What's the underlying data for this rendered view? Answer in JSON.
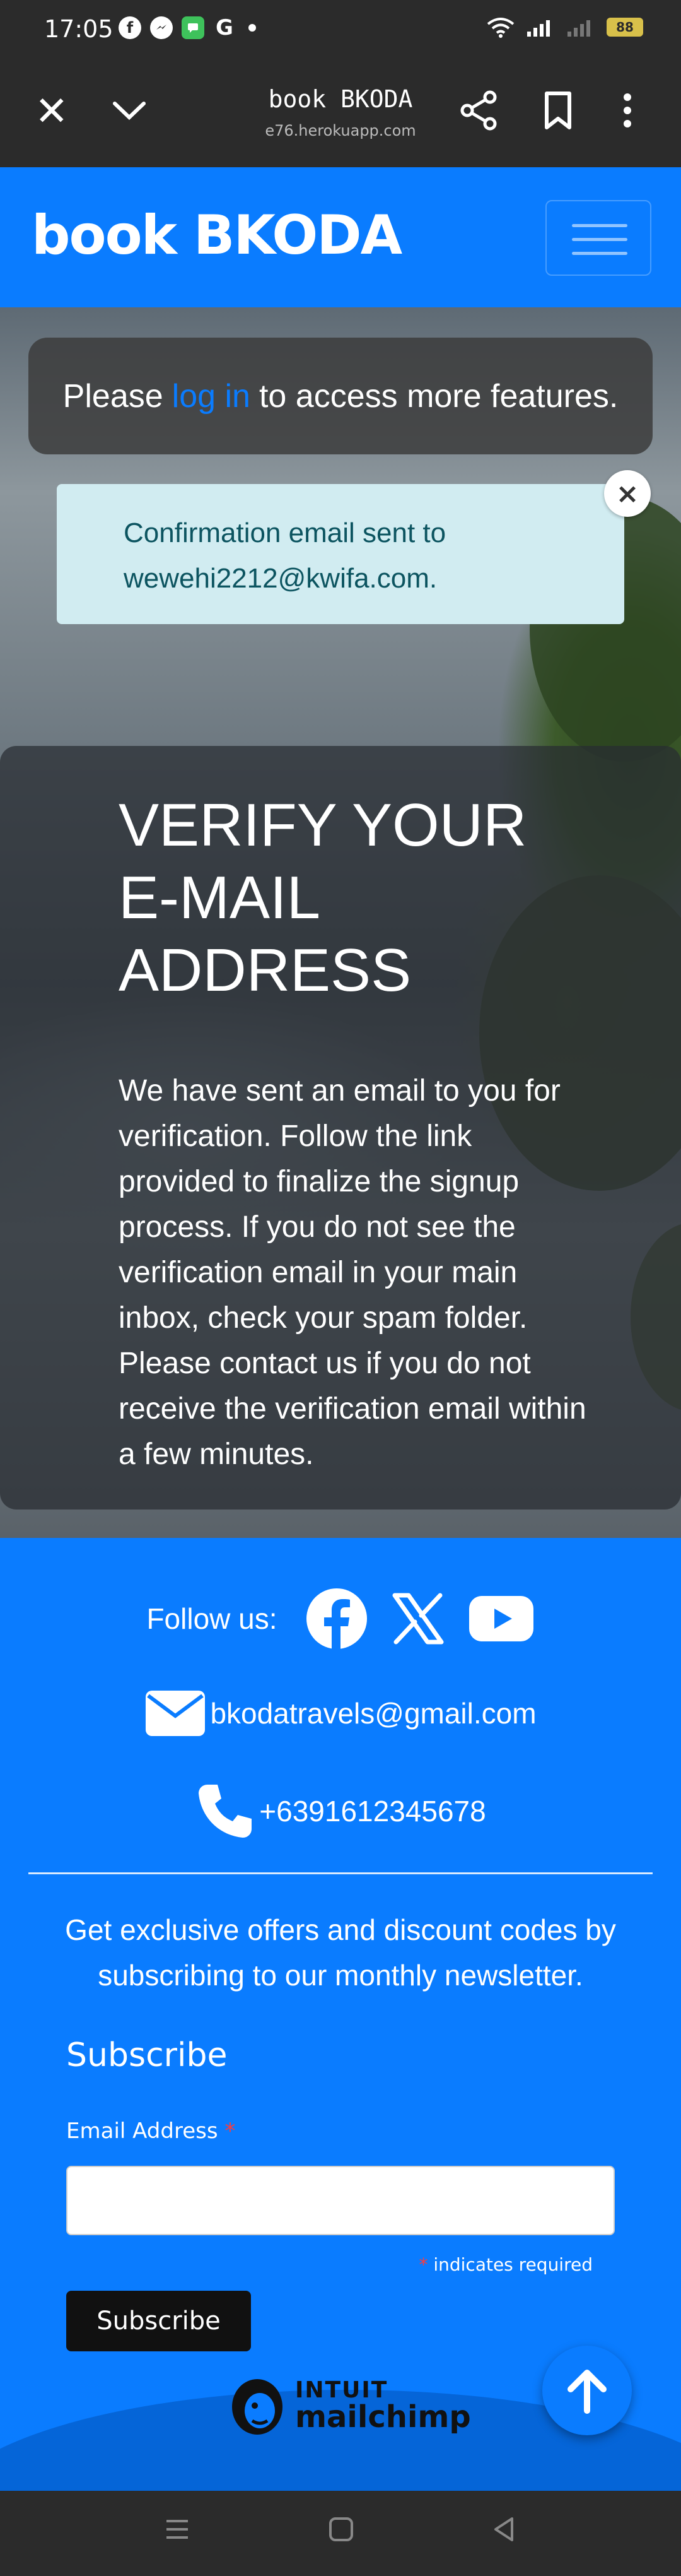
{
  "status_bar": {
    "time": "17:05",
    "battery": "88",
    "notification_icons": [
      "facebook-icon",
      "messenger-icon",
      "chat-icon",
      "google-icon"
    ]
  },
  "browser": {
    "title": "book BKODA",
    "url": "e76.herokuapp.com"
  },
  "navbar": {
    "brand": "book BKODA"
  },
  "login_prompt": {
    "before": "Please",
    "link": "log in",
    "after": "to access more features."
  },
  "alert": {
    "line1": "Confirmation email sent to",
    "line2": "wewehi2212@kwifa.com.",
    "close": "×"
  },
  "verify": {
    "title_lines": [
      "VERIFY YOUR",
      "E-MAIL",
      "ADDRESS"
    ],
    "body": "We have sent an email to you for verification. Follow the link provided to finalize the signup process. If you do not see the verification email in your main inbox, check your spam folder. Please contact us if you do not receive the verification email within a few minutes."
  },
  "footer": {
    "follow_label": "Follow us:",
    "social": [
      "facebook-icon",
      "x-icon",
      "youtube-icon"
    ],
    "email": "bkodatravels@gmail.com",
    "phone": "+6391612345678",
    "newsletter_text": "Get exclusive offers and discount codes by subscribing to our monthly newsletter.",
    "subscribe_title": "Subscribe",
    "email_label": "Email Address",
    "required_mark": "*",
    "email_value": "",
    "required_note": "indicates required",
    "subscribe_button": "Subscribe",
    "mailchimp_top": "INTUIT",
    "mailchimp_bottom": "mailchimp"
  },
  "colors": {
    "brand_blue": "#0a7cff",
    "alert_bg": "#d1ecf1",
    "alert_text": "#0c5460",
    "dark_bar": "#2b2b2b"
  }
}
